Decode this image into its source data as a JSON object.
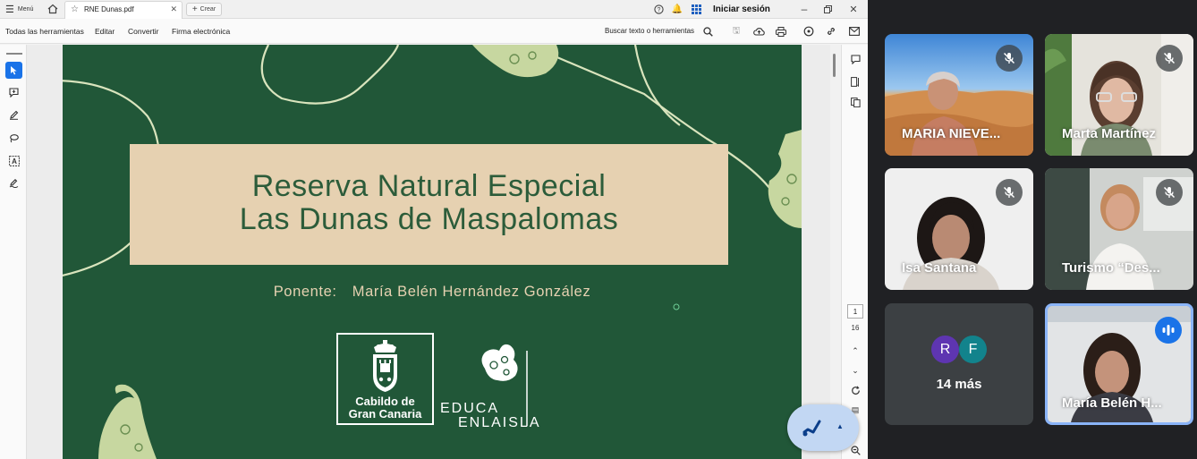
{
  "acrobat": {
    "menu_label": "Menú",
    "tab_title": "RNE Dunas.pdf",
    "new_tab_label": "Crear",
    "signin_label": "Iniciar sesión",
    "menus": [
      "Todas las herramientas",
      "Editar",
      "Convertir",
      "Firma electrónica"
    ],
    "search_label": "Buscar texto o herramientas",
    "page_current": "1",
    "page_total": "16"
  },
  "slide": {
    "title_line1": "Reserva Natural Especial",
    "title_line2": "Las Dunas de Maspalomas",
    "speaker_label": "Ponente:",
    "speaker_name": "María Belén Hernández González",
    "logo1_line1": "Cabildo de",
    "logo1_line2": "Gran Canaria",
    "logo2_line1": "EDUCA",
    "logo2_line2": "ENLAISLA",
    "bg_color": "#215738",
    "box_color": "#e6d1b1",
    "title_color": "#2c5c3a"
  },
  "meet": {
    "participants": [
      {
        "name": "MARIA NIEVE...",
        "muted": true
      },
      {
        "name": "Marta Martínez",
        "muted": true
      },
      {
        "name": "Isa Santana",
        "muted": true
      },
      {
        "name": "Turismo “Des...",
        "muted": true
      },
      {
        "name": "María Belén H...",
        "speaking": true
      }
    ],
    "others": {
      "initials": [
        "R",
        "F"
      ],
      "label": "14 más"
    }
  }
}
